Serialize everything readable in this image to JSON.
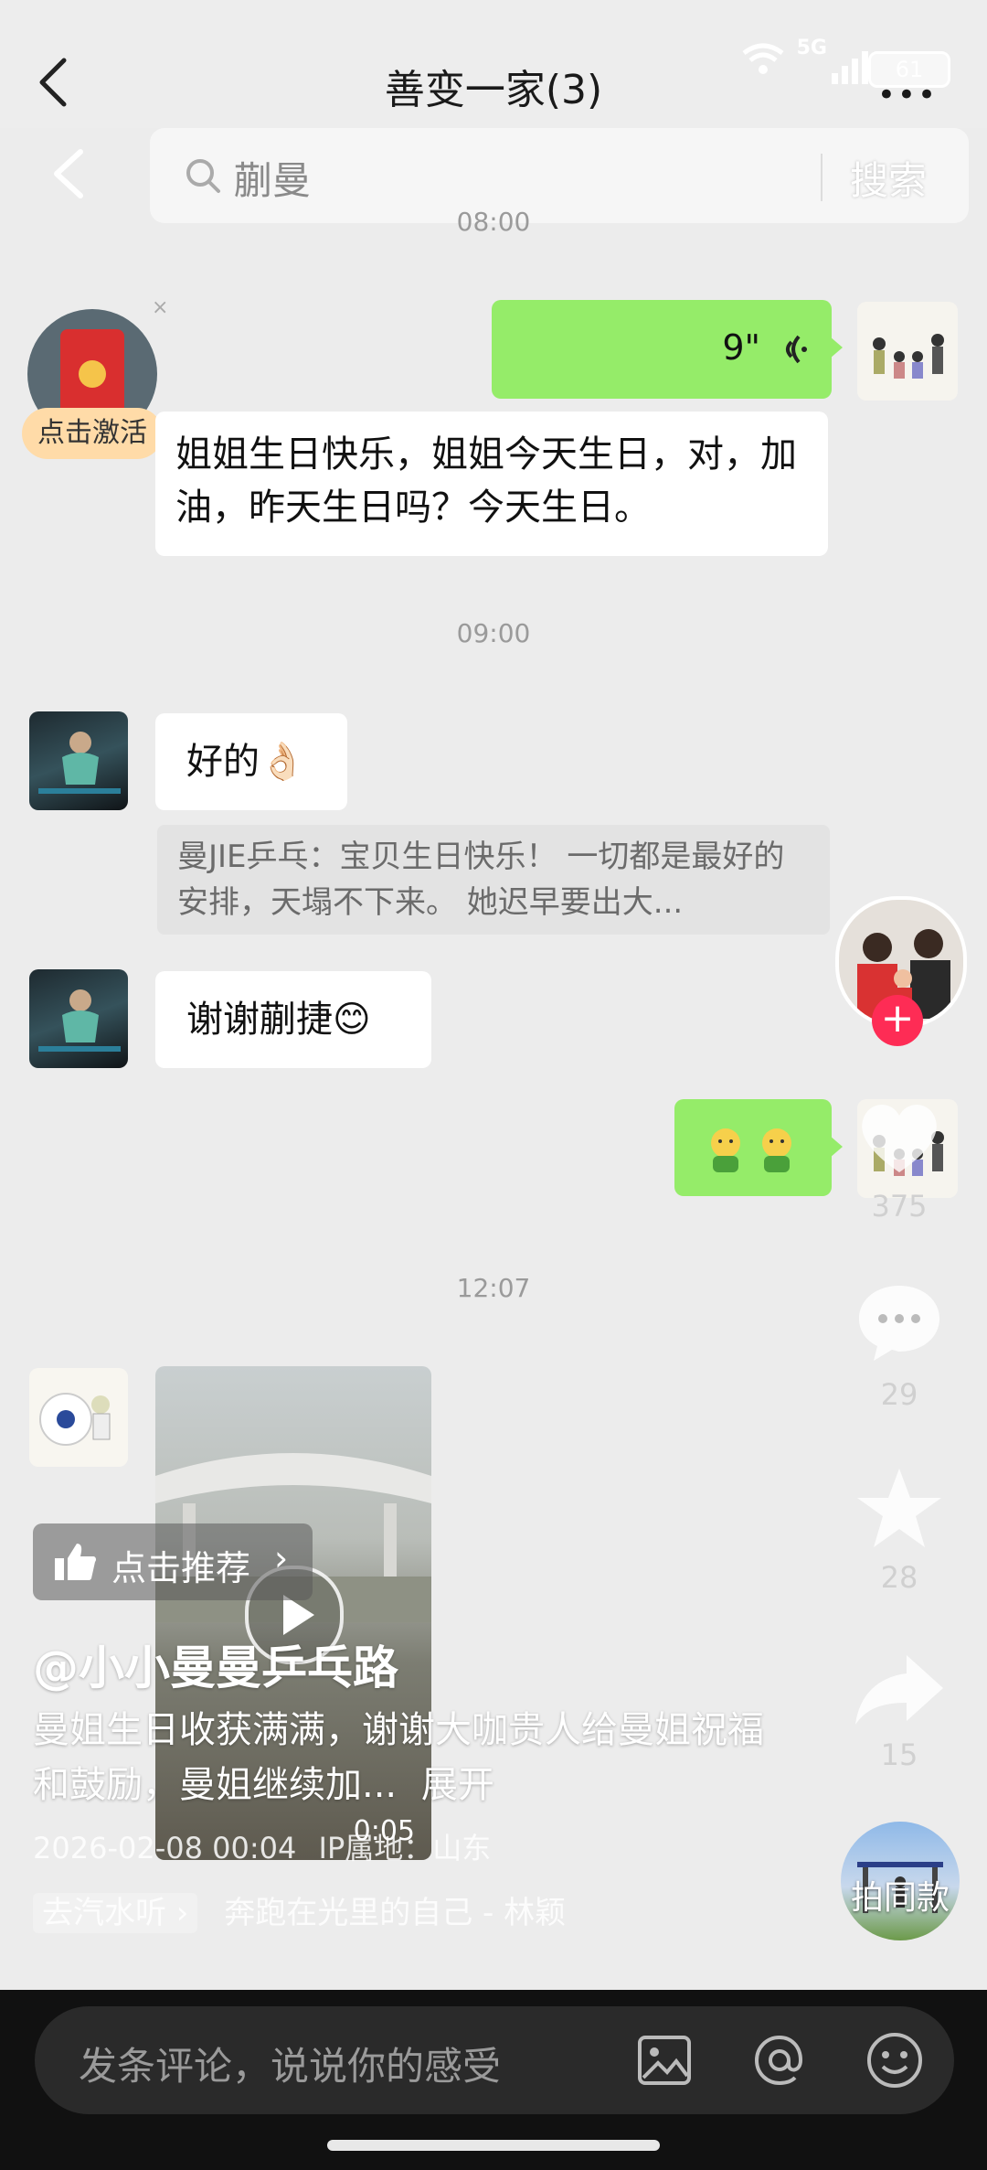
{
  "chat": {
    "title": "善变一家(3)",
    "more": "•••"
  },
  "status_bar": {
    "network": "5G",
    "battery": "61"
  },
  "search": {
    "query": "蒯曼",
    "button": "搜索"
  },
  "timestamps": [
    "08:00",
    "09:00",
    "12:07"
  ],
  "messages": {
    "redpacket_badge": "点击激活",
    "voice_duration": "9\"",
    "long_text": "姐姐生日快乐，姐姐今天生日，对，加油，昨天生日吗？今天生日。",
    "reply_ok": "好的👌🏻",
    "quote": "曼JIE乒乓：宝贝生日快乐！ 一切都是最好的安排，天塌不下来。 她迟早要出大...",
    "thanks": "谢谢蒯捷😊",
    "video_duration": "0:05"
  },
  "douyin": {
    "like_count": "375",
    "comment_count": "29",
    "fav_count": "28",
    "share_count": "15",
    "recommend": "点击推荐",
    "author": "@小小曼曼乒乓路",
    "caption": "曼姐生日收获满满，谢谢大咖贵人给曼姐祝福和鼓励，曼姐继续加...",
    "expand": "展开",
    "date": "2026-02-08 00:04",
    "ip": "IP属地：山东",
    "music_tag": "去汽水听 ›",
    "music": "奔跑在光里的自己 - 林颖",
    "same_style": "拍同款"
  },
  "comment_bar": {
    "placeholder": "发条评论，说说你的感受"
  },
  "colors": {
    "green_bubble": "#95ec69",
    "like_red": "#fe2c55",
    "badge_orange": "#ffd8a8"
  }
}
